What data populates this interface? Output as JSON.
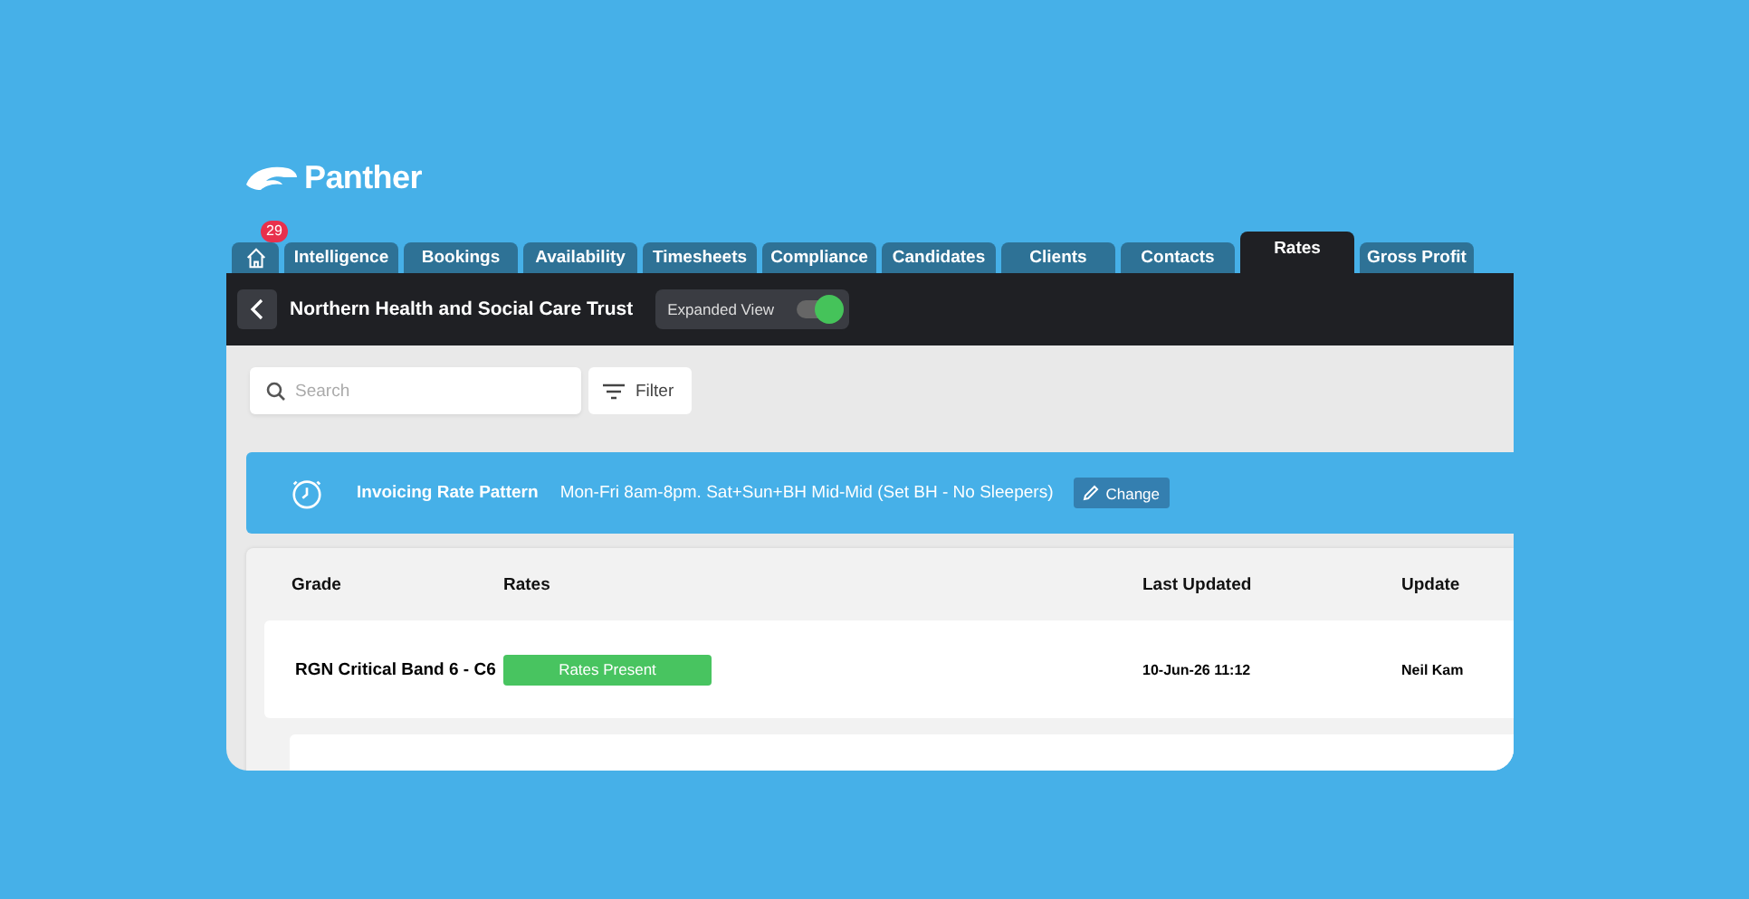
{
  "brand": {
    "name": "Panther"
  },
  "tabs": [
    {
      "kind": "home",
      "badge": "29",
      "selected": false
    },
    {
      "label": "Intelligence",
      "selected": false
    },
    {
      "label": "Bookings",
      "selected": false
    },
    {
      "label": "Availability",
      "selected": false
    },
    {
      "label": "Timesheets",
      "selected": false
    },
    {
      "label": "Compliance",
      "selected": false
    },
    {
      "label": "Candidates",
      "selected": false
    },
    {
      "label": "Clients",
      "selected": false
    },
    {
      "label": "Contacts",
      "selected": false
    },
    {
      "label": "Rates",
      "selected": true
    },
    {
      "label": "Gross Profit",
      "selected": false
    }
  ],
  "header": {
    "title": "Northern Health and Social Care Trust",
    "toggle_label": "Expanded View",
    "toggle_on": true
  },
  "search": {
    "placeholder": "Search"
  },
  "filter_button": "Filter",
  "banner": {
    "label": "Invoicing Rate Pattern",
    "value": "Mon-Fri 8am-8pm. Sat+Sun+BH Mid-Mid (Set BH - No Sleepers)",
    "button": "Change"
  },
  "table": {
    "columns": [
      "Grade",
      "Rates",
      "Last Updated",
      "Update"
    ],
    "rows": [
      {
        "grade": "RGN Critical Band 6 - C6",
        "rates": "Rates Present",
        "last_updated": "10-Jun-26 11:12",
        "updated_by": "Neil Kam"
      }
    ]
  }
}
